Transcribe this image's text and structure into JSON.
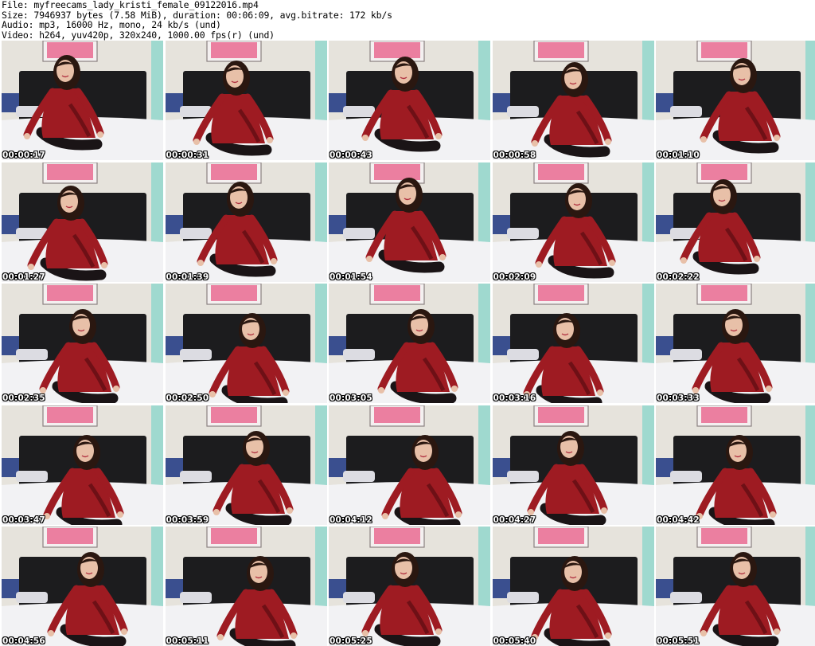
{
  "header": {
    "file_line": "File: myfreecams_lady_kristi_female_09122016.mp4",
    "size_line": "Size: 7946937 bytes (7.58 MiB), duration: 00:06:09, avg.bitrate: 172 kb/s",
    "audio_line": "Audio: mp3, 16000 Hz, mono, 24 kb/s (und)",
    "video_line": "Video: h264, yuv420p, 320x240, 1000.00 fps(r) (und)"
  },
  "colors": {
    "wall": "#e6e3dc",
    "headboard": "#1c1c1e",
    "sheet": "#f2f2f4",
    "dress": "#9e1b22",
    "dress_shade": "#6e1016",
    "skin": "#e8c0a8",
    "hair": "#2a1710",
    "stockings": "#1a1416",
    "picture_frame": "#f4f0f0",
    "picture_flowers": "#e85a86",
    "curtain": "#9fd9cf"
  },
  "thumbnails": [
    {
      "timestamp": "00:00:17"
    },
    {
      "timestamp": "00:00:31"
    },
    {
      "timestamp": "00:00:43"
    },
    {
      "timestamp": "00:00:58"
    },
    {
      "timestamp": "00:01:10"
    },
    {
      "timestamp": "00:01:27"
    },
    {
      "timestamp": "00:01:39"
    },
    {
      "timestamp": "00:01:54"
    },
    {
      "timestamp": "00:02:09"
    },
    {
      "timestamp": "00:02:22"
    },
    {
      "timestamp": "00:02:35"
    },
    {
      "timestamp": "00:02:50"
    },
    {
      "timestamp": "00:03:05"
    },
    {
      "timestamp": "00:03:16"
    },
    {
      "timestamp": "00:03:33"
    },
    {
      "timestamp": "00:03:47"
    },
    {
      "timestamp": "00:03:59"
    },
    {
      "timestamp": "00:04:12"
    },
    {
      "timestamp": "00:04:27"
    },
    {
      "timestamp": "00:04:42"
    },
    {
      "timestamp": "00:04:56"
    },
    {
      "timestamp": "00:05:11"
    },
    {
      "timestamp": "00:05:25"
    },
    {
      "timestamp": "00:05:40"
    },
    {
      "timestamp": "00:05:51"
    }
  ]
}
